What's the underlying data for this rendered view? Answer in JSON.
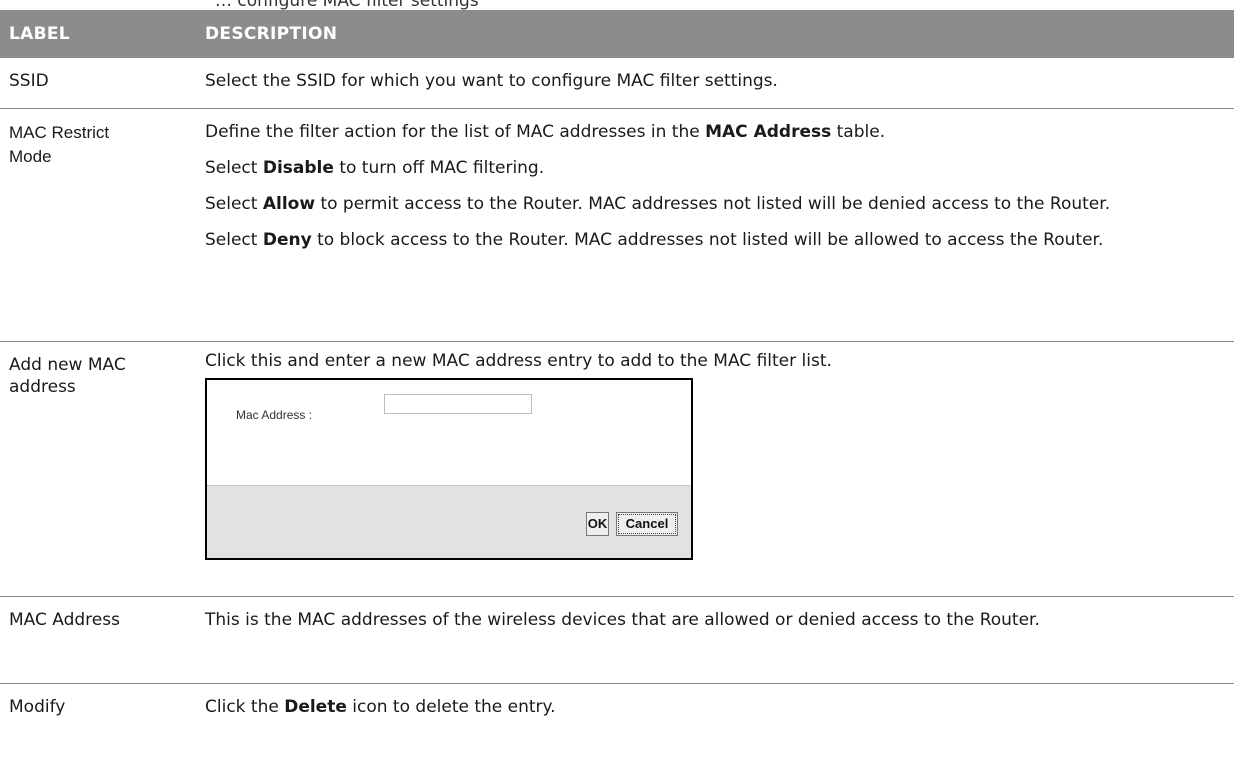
{
  "caption_partial": "… configure MAC filter settings",
  "header": {
    "label": "LABEL",
    "description": "DESCRIPTION"
  },
  "rows": {
    "ssid": {
      "label": "SSID",
      "text": "Select the SSID for which you want to configure MAC filter settings."
    },
    "mode": {
      "label_line1": "MAC Restrict",
      "label_line2": "Mode",
      "p1_pre": "Define the filter action for the list of MAC addresses in the ",
      "p1_bold": "MAC Address",
      "p1_post": " table.",
      "p2_pre": "Select ",
      "p2_bold": "Disable",
      "p2_post": " to turn off MAC filtering.",
      "p3_pre": "Select ",
      "p3_bold": "Allow",
      "p3_post": " to permit access to the Router. MAC addresses not listed will be denied access to the Router.",
      "p4_pre": "Select ",
      "p4_bold": "Deny",
      "p4_post": " to block access to the Router. MAC addresses not listed will be allowed to access the Router."
    },
    "add": {
      "label_line1": "Add new MAC",
      "label_line2": "address",
      "text": "Click this and enter a new MAC address entry to add to the MAC filter list.",
      "dialog": {
        "field_label": "Mac Address :",
        "field_value": "",
        "ok_label": "OK",
        "cancel_label": "Cancel"
      }
    },
    "address": {
      "label": "MAC Address",
      "text": "This is the MAC addresses of the wireless devices that are allowed or denied access to the Router."
    },
    "modify": {
      "label": "Modify",
      "text_pre": "Click the ",
      "text_bold": "Delete",
      "text_post": " icon to delete the entry."
    }
  }
}
